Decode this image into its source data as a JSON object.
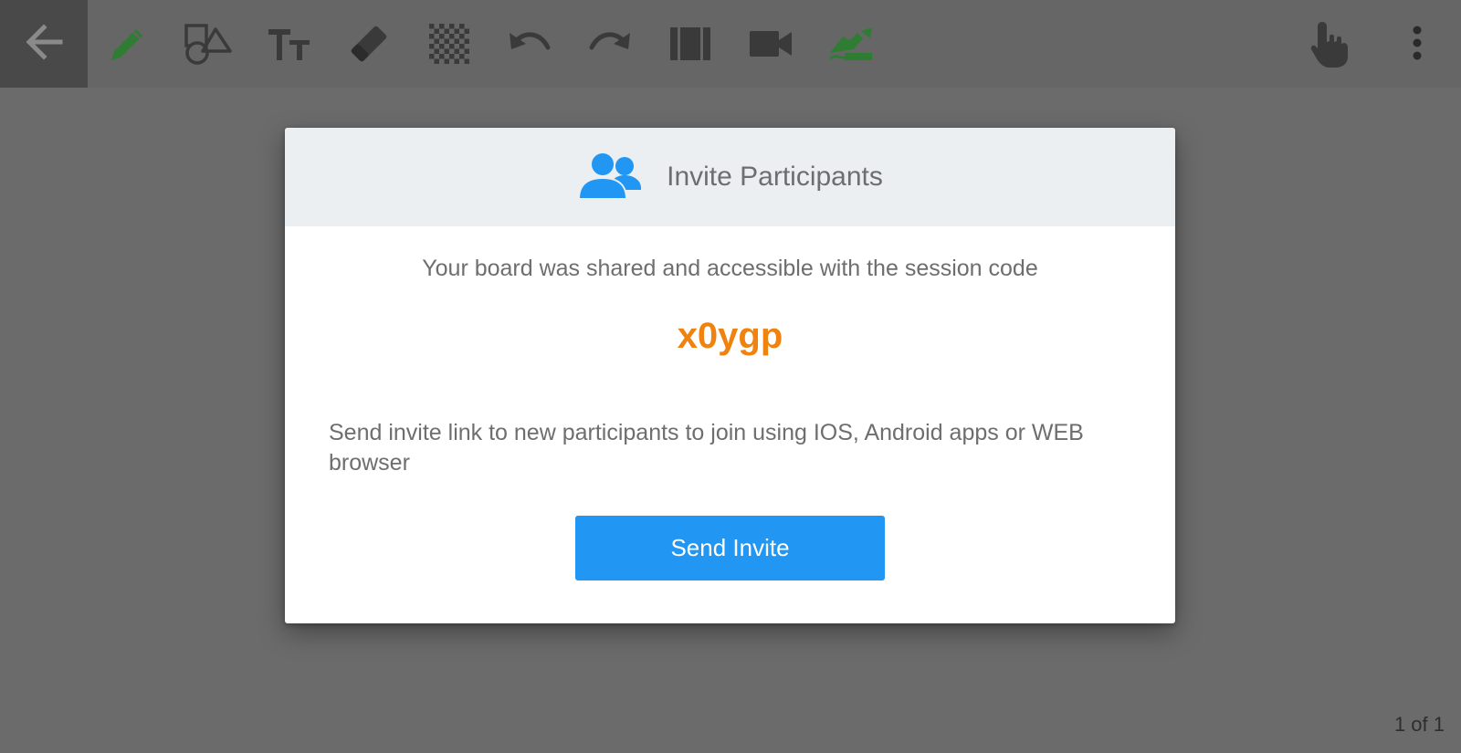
{
  "toolbar": {
    "icons": [
      "back-arrow-icon",
      "pencil-icon",
      "shapes-icon",
      "text-size-icon",
      "eraser-icon",
      "transparency-grid-icon",
      "undo-icon",
      "redo-icon",
      "book-pages-icon",
      "video-camera-icon",
      "hand-sign-icon",
      "pointer-hand-icon",
      "more-options-icon"
    ],
    "colors": {
      "active_tool": "#2e7d32",
      "icon": "#3a3a3a"
    }
  },
  "dialog": {
    "title": "Invite Participants",
    "title_icon": "participants-icon",
    "message": "Your board was shared and accessible with the session code",
    "session_code": "x0ygp",
    "invite_text": "Send invite link to new participants to join using IOS, Android apps or WEB browser",
    "send_button_label": "Send Invite",
    "colors": {
      "code": "#f0820f",
      "button": "#2196f3"
    }
  },
  "footer": {
    "page_indicator": "1 of 1"
  }
}
